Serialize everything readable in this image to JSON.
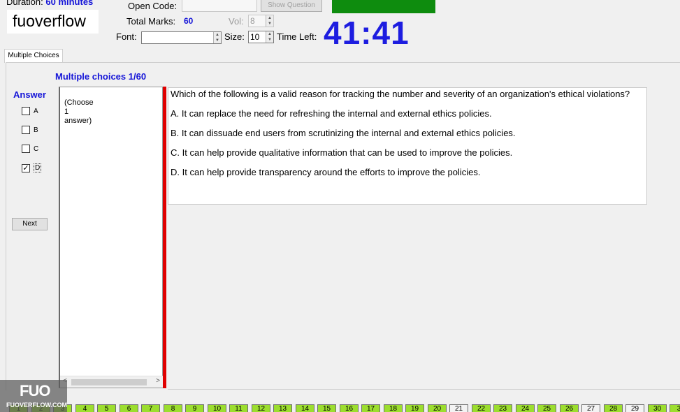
{
  "header": {
    "duration_label": "Duration:",
    "duration_value": "60 minutes",
    "logo_text": "fuoverflow",
    "open_code_label": "Open Code:",
    "open_code_value": "",
    "show_question_label": "Show Question",
    "total_marks_label": "Total Marks:",
    "total_marks_value": "60",
    "vol_label": "Vol:",
    "vol_value": "8",
    "font_label": "Font:",
    "font_value": "",
    "size_label": "Size:",
    "size_value": "10",
    "time_left_label": "Time Left:",
    "time_left_value": "41:41",
    "status_color": "#0e8c0e",
    "timer_color": "#1d1de0"
  },
  "tabs": [
    {
      "label": "Multiple Choices",
      "active": true
    }
  ],
  "question_header": "Multiple choices 1/60",
  "answer_panel": {
    "title": "Answer",
    "options": [
      {
        "letter": "A",
        "checked": false
      },
      {
        "letter": "B",
        "checked": false
      },
      {
        "letter": "C",
        "checked": false
      },
      {
        "letter": "D",
        "checked": true
      }
    ],
    "next_label": "Next"
  },
  "choose_panel": {
    "line1": "(Choose",
    "line2": "1",
    "line3": "answer)"
  },
  "question": {
    "text": "Which of the following is a valid reason for tracking the number and severity of an organization's ethical violations?",
    "answers": [
      "A.  It can replace the need for refreshing the internal and external ethics policies.",
      "B.  It can dissuade end users from scrutinizing the internal and external ethics policies.",
      "C.  It can help provide qualitative information that can be used to improve the policies.",
      "D.  It can help provide transparency around the efforts to improve the policies."
    ]
  },
  "nav": {
    "buttons": [
      {
        "n": "1",
        "answered": true
      },
      {
        "n": "2",
        "answered": true
      },
      {
        "n": "3",
        "answered": true
      },
      {
        "n": "4",
        "answered": true
      },
      {
        "n": "5",
        "answered": true
      },
      {
        "n": "6",
        "answered": true
      },
      {
        "n": "7",
        "answered": true
      },
      {
        "n": "8",
        "answered": true
      },
      {
        "n": "9",
        "answered": true
      },
      {
        "n": "10",
        "answered": true
      },
      {
        "n": "11",
        "answered": true
      },
      {
        "n": "12",
        "answered": true
      },
      {
        "n": "13",
        "answered": true
      },
      {
        "n": "14",
        "answered": true
      },
      {
        "n": "15",
        "answered": true
      },
      {
        "n": "16",
        "answered": true
      },
      {
        "n": "17",
        "answered": true
      },
      {
        "n": "18",
        "answered": true
      },
      {
        "n": "19",
        "answered": true
      },
      {
        "n": "20",
        "answered": true
      },
      {
        "n": "21",
        "answered": false
      },
      {
        "n": "22",
        "answered": true
      },
      {
        "n": "23",
        "answered": true
      },
      {
        "n": "24",
        "answered": true
      },
      {
        "n": "25",
        "answered": true
      },
      {
        "n": "26",
        "answered": true
      },
      {
        "n": "27",
        "answered": false
      },
      {
        "n": "28",
        "answered": true
      },
      {
        "n": "29",
        "answered": false
      },
      {
        "n": "30",
        "answered": true
      },
      {
        "n": "3",
        "answered": true
      }
    ],
    "answered_color": "#9cde2e"
  },
  "watermark": {
    "big": "FUO",
    "small": "FUOVERFLOW.COM"
  }
}
